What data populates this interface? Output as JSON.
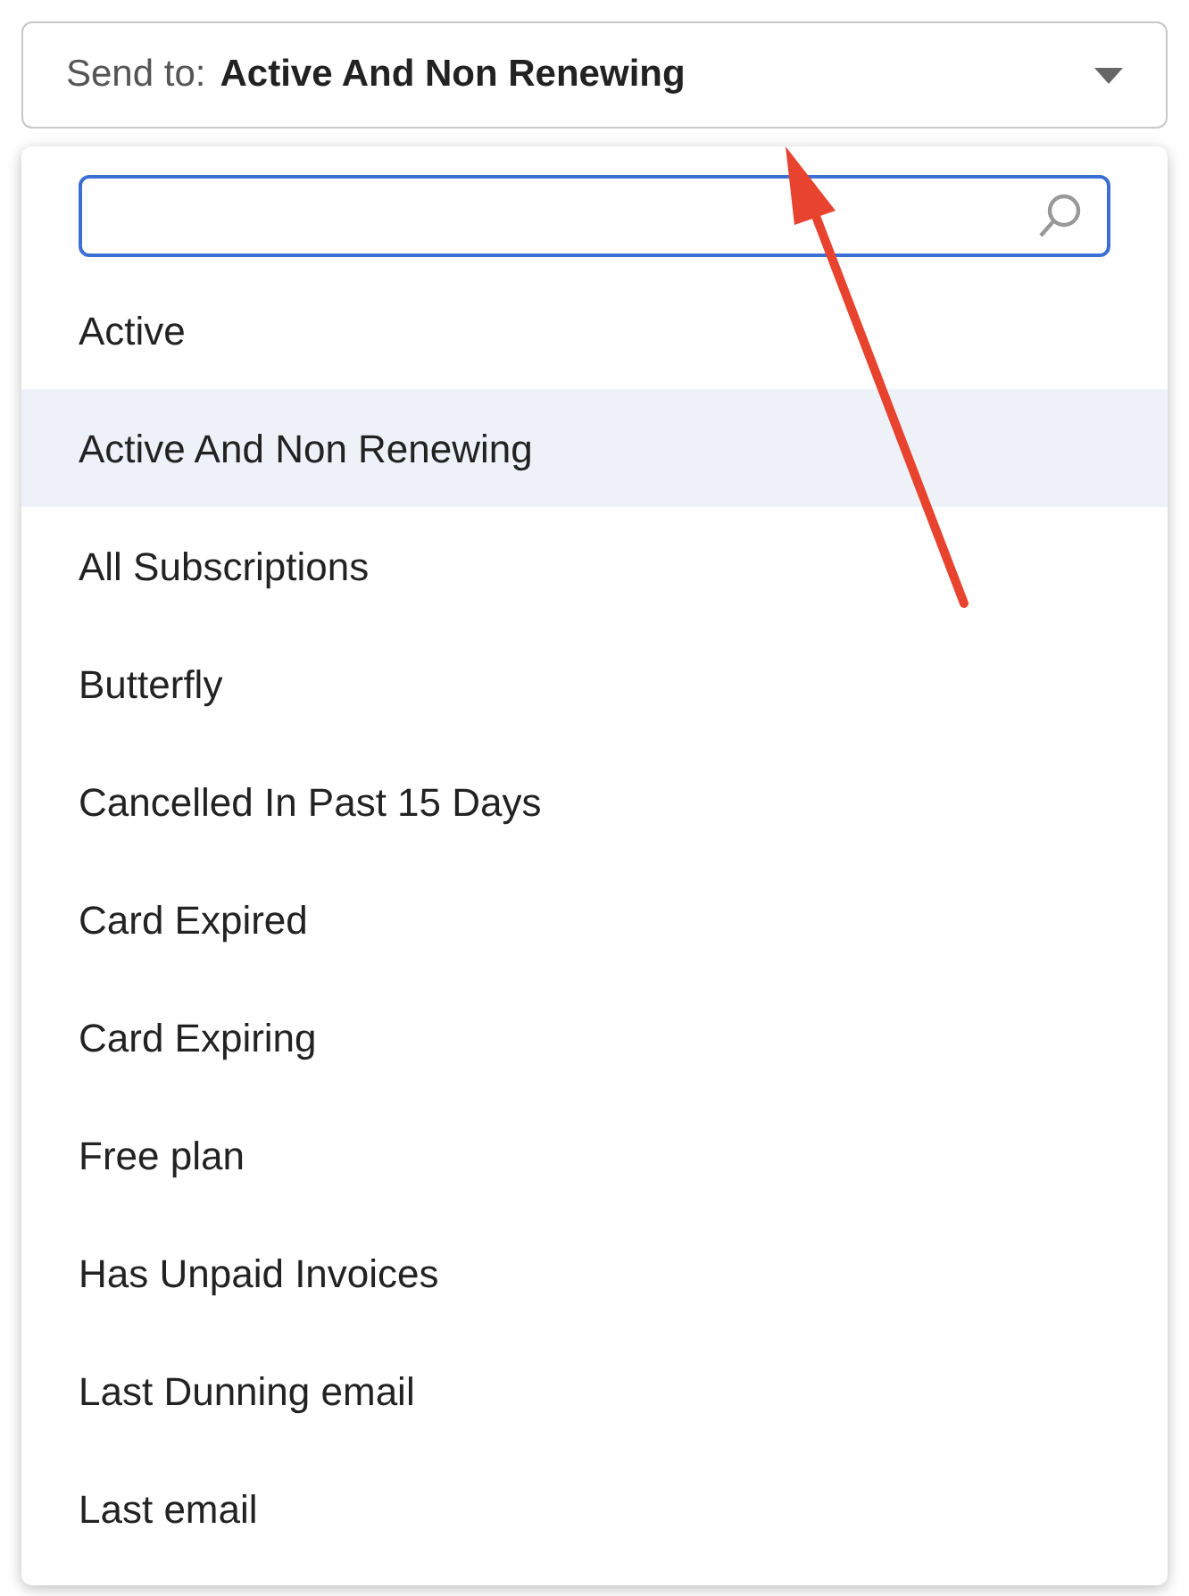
{
  "select": {
    "label": "Send to:",
    "value": "Active And Non Renewing"
  },
  "options": [
    {
      "label": "Active",
      "selected": false
    },
    {
      "label": "Active And Non Renewing",
      "selected": true
    },
    {
      "label": "All Subscriptions",
      "selected": false
    },
    {
      "label": "Butterfly",
      "selected": false
    },
    {
      "label": "Cancelled In Past 15 Days",
      "selected": false
    },
    {
      "label": "Card Expired",
      "selected": false
    },
    {
      "label": "Card Expiring",
      "selected": false
    },
    {
      "label": "Free plan",
      "selected": false
    },
    {
      "label": "Has Unpaid Invoices",
      "selected": false
    },
    {
      "label": "Last Dunning email",
      "selected": false
    },
    {
      "label": "Last email",
      "selected": false
    }
  ]
}
